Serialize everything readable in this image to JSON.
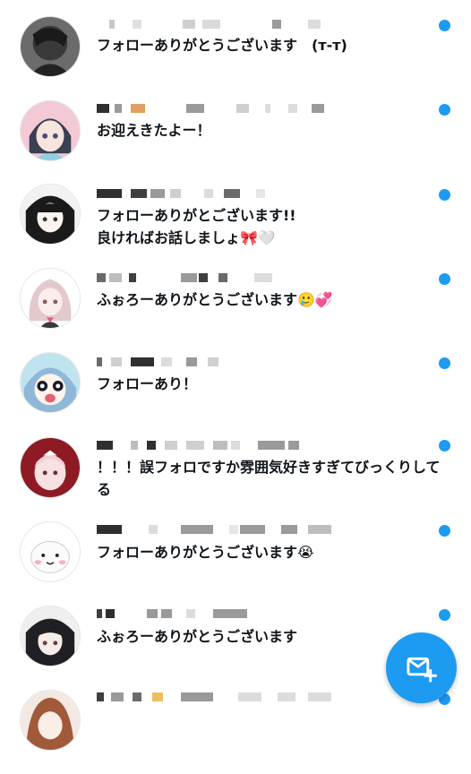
{
  "accent_color": "#1d9bf0",
  "compose_icon": "new-message-icon",
  "messages": [
    {
      "text": "フォローありがとうございます　(т-т)"
    },
    {
      "text": "お迎えきたよー！"
    },
    {
      "text": "フォローありがとございます!!\n良ければお話しましょ🎀🤍"
    },
    {
      "text": "ふぉろーありがとうございます🥲💞"
    },
    {
      "text": "フォローあり！"
    },
    {
      "text": "！！！誤フォロですか雰囲気好きすぎてびっくりしてる"
    },
    {
      "text": "フォローありがとうございます😭"
    },
    {
      "text": "ふぉろーありがとうございます"
    },
    {
      "text": ""
    }
  ]
}
